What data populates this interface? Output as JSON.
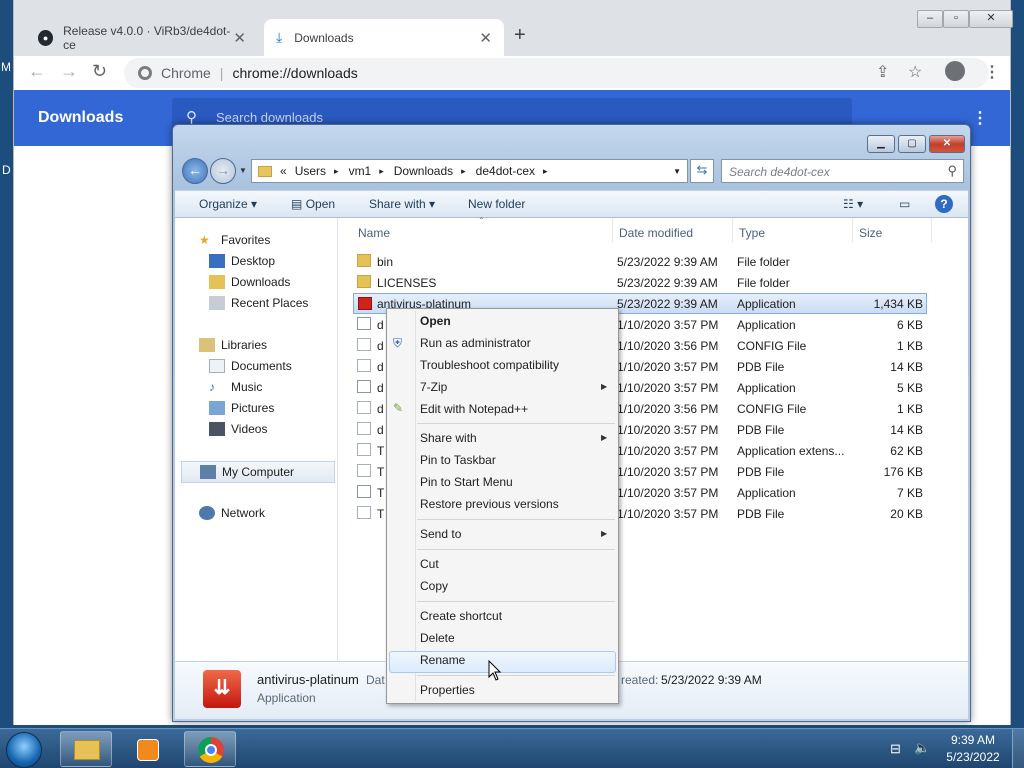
{
  "desktop": {
    "frag1": "M",
    "frag2": "D"
  },
  "browser": {
    "tabs": [
      {
        "label": "Release v4.0.0 · ViRb3/de4dot-ce",
        "icon": "github-icon"
      },
      {
        "label": "Downloads",
        "icon": "download-icon"
      }
    ],
    "omnibox": {
      "scheme": "Chrome",
      "url": "chrome://downloads"
    },
    "page_title": "Downloads",
    "search_placeholder": "Search downloads"
  },
  "explorer": {
    "breadcrumb": [
      "Users",
      "vm1",
      "Downloads",
      "de4dot-cex"
    ],
    "search_placeholder": "Search de4dot-cex",
    "commands": {
      "organize": "Organize",
      "open": "Open",
      "share": "Share with",
      "new_folder": "New folder"
    },
    "nav": {
      "favorites": "Favorites",
      "desktop": "Desktop",
      "downloads": "Downloads",
      "recent": "Recent Places",
      "libraries": "Libraries",
      "documents": "Documents",
      "music": "Music",
      "pictures": "Pictures",
      "videos": "Videos",
      "computer": "My Computer",
      "network": "Network"
    },
    "columns": {
      "name": "Name",
      "date": "Date modified",
      "type": "Type",
      "size": "Size"
    },
    "files": [
      {
        "name": "bin",
        "date": "5/23/2022 9:39 AM",
        "type": "File folder",
        "size": "",
        "icon": "folder"
      },
      {
        "name": "LICENSES",
        "date": "5/23/2022 9:39 AM",
        "type": "File folder",
        "size": "",
        "icon": "folder"
      },
      {
        "name": "antivirus-platinum",
        "date": "5/23/2022 9:39 AM",
        "type": "Application",
        "size": "1,434 KB",
        "icon": "appred"
      },
      {
        "name": "d",
        "date": "1/10/2020 3:57 PM",
        "type": "Application",
        "size": "6 KB",
        "icon": "appicon"
      },
      {
        "name": "d",
        "date": "1/10/2020 3:56 PM",
        "type": "CONFIG File",
        "size": "1 KB",
        "icon": "docicon"
      },
      {
        "name": "d",
        "date": "1/10/2020 3:57 PM",
        "type": "PDB File",
        "size": "14 KB",
        "icon": "docicon"
      },
      {
        "name": "d",
        "date": "1/10/2020 3:57 PM",
        "type": "Application",
        "size": "5 KB",
        "icon": "appicon"
      },
      {
        "name": "d",
        "date": "1/10/2020 3:56 PM",
        "type": "CONFIG File",
        "size": "1 KB",
        "icon": "docicon"
      },
      {
        "name": "d",
        "date": "1/10/2020 3:57 PM",
        "type": "PDB File",
        "size": "14 KB",
        "icon": "docicon"
      },
      {
        "name": "T",
        "date": "1/10/2020 3:57 PM",
        "type": "Application extens...",
        "size": "62 KB",
        "icon": "docicon"
      },
      {
        "name": "T",
        "date": "1/10/2020 3:57 PM",
        "type": "PDB File",
        "size": "176 KB",
        "icon": "docicon"
      },
      {
        "name": "T",
        "date": "1/10/2020 3:57 PM",
        "type": "Application",
        "size": "7 KB",
        "icon": "appicon"
      },
      {
        "name": "T",
        "date": "1/10/2020 3:57 PM",
        "type": "PDB File",
        "size": "20 KB",
        "icon": "docicon"
      }
    ],
    "details": {
      "name": "antivirus-platinum",
      "type": "Application",
      "date_frag": "Dat",
      "created_label": "reated:",
      "created_value": "5/23/2022 9:39 AM"
    }
  },
  "context_menu": {
    "items": [
      {
        "label": "Open",
        "bold": true
      },
      {
        "label": "Run as administrator"
      },
      {
        "label": "Troubleshoot compatibility"
      },
      {
        "label": "7-Zip",
        "submenu": true
      },
      {
        "label": "Edit with Notepad++"
      },
      {
        "label": "Share with",
        "submenu": true
      },
      {
        "label": "Pin to Taskbar"
      },
      {
        "label": "Pin to Start Menu"
      },
      {
        "label": "Restore previous versions"
      },
      {
        "label": "Send to",
        "submenu": true
      },
      {
        "label": "Cut"
      },
      {
        "label": "Copy"
      },
      {
        "label": "Create shortcut"
      },
      {
        "label": "Delete"
      },
      {
        "label": "Rename",
        "highlighted": true
      },
      {
        "label": "Properties"
      }
    ]
  },
  "taskbar": {
    "time": "9:39 AM",
    "date": "5/23/2022"
  }
}
